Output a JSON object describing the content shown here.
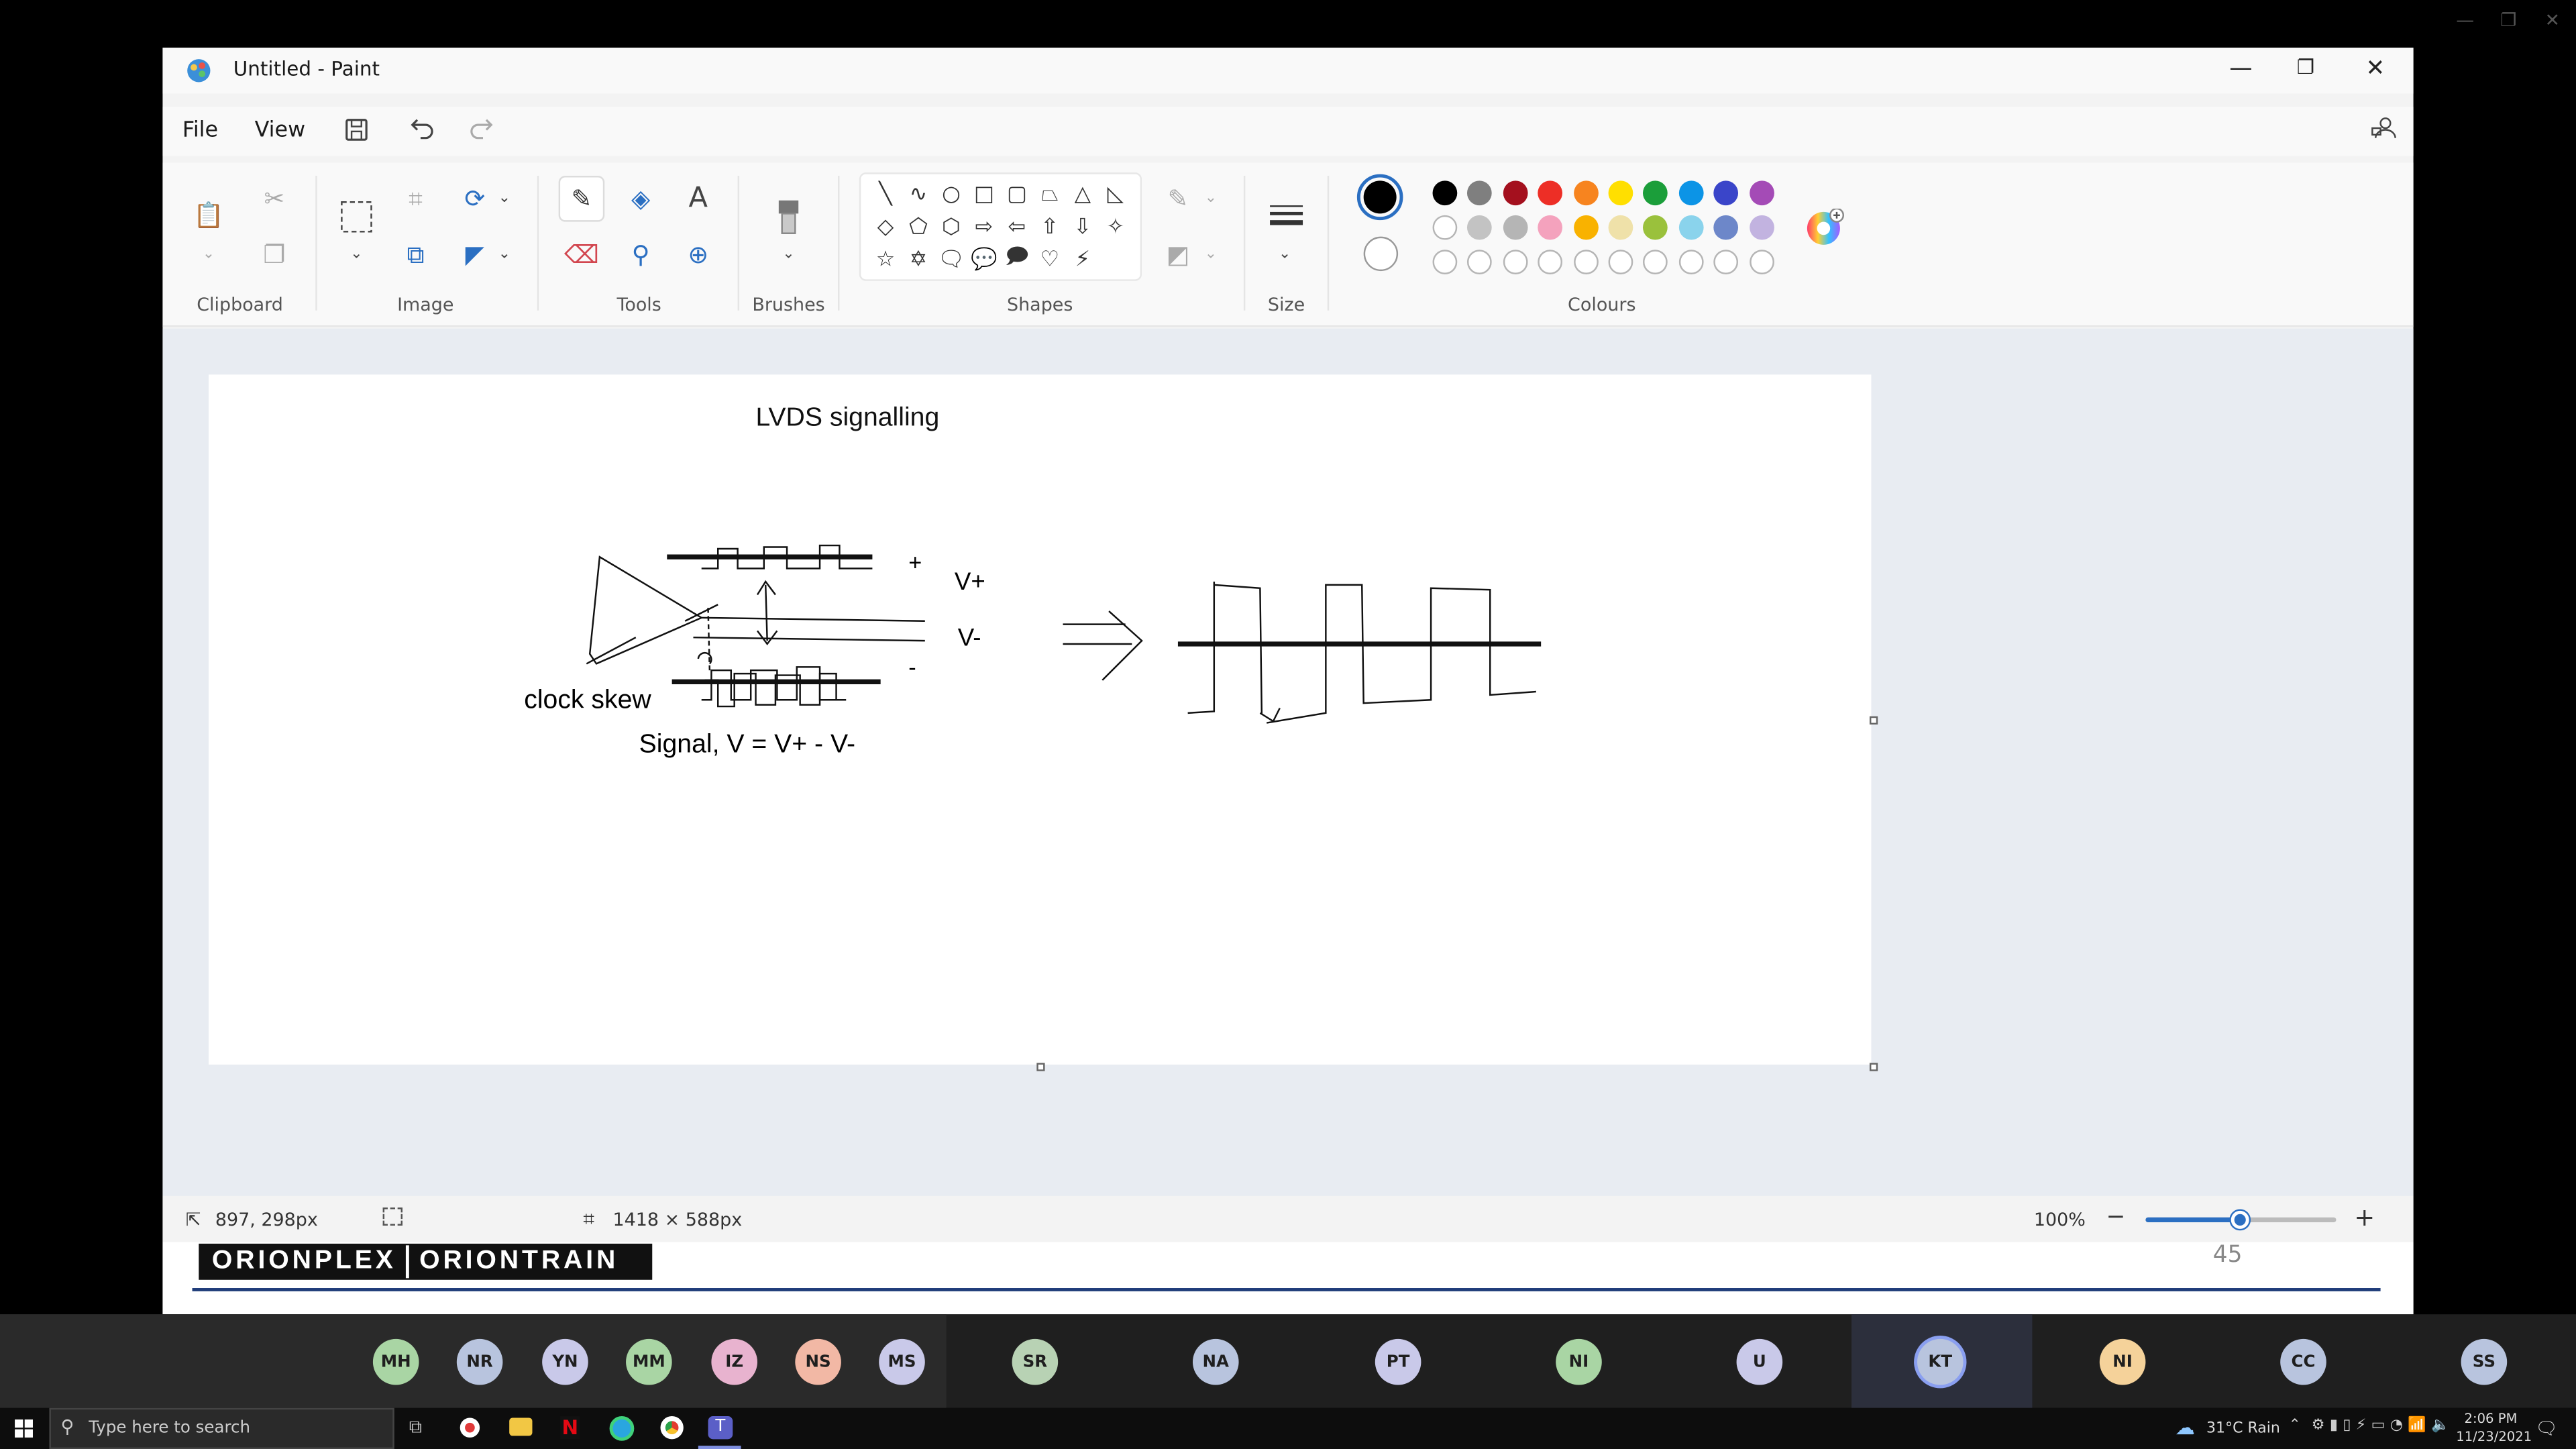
{
  "window": {
    "title": "Untitled - Paint"
  },
  "menu": {
    "file": "File",
    "view": "View"
  },
  "ribbon": {
    "groups": {
      "clipboard": "Clipboard",
      "image": "Image",
      "tools": "Tools",
      "brushes": "Brushes",
      "shapes": "Shapes",
      "size": "Size",
      "colours": "Colours"
    }
  },
  "palette": {
    "primary": "#000000",
    "row1": [
      "#000000",
      "#7f7f7f",
      "#a4101e",
      "#ed2e26",
      "#f7841f",
      "#ffdf00",
      "#1b9e3a",
      "#0c94e6",
      "#3a45c9",
      "#a44bb6"
    ],
    "row2": [
      "#ffffff",
      "#c3c3c3",
      "#b5b5b5",
      "#f4a2bd",
      "#f9b200",
      "#efe1a9",
      "#9ac13c",
      "#8ad3ec",
      "#6d87c9",
      "#c2b3e0"
    ]
  },
  "canvas_text": {
    "title": "LVDS signalling",
    "plus": "+",
    "vplus": "V+",
    "vminus": "V-",
    "minus": "-",
    "clock_skew": "clock skew",
    "signal": "Signal, V = V+ - V-"
  },
  "status": {
    "cursor": "897, 298px",
    "canvas_size": "1418 × 588px",
    "zoom": "100%",
    "zoom_level": 0.5
  },
  "slide": {
    "logo_left": "ORIONPLEX",
    "logo_right": "ORIONTRAIN",
    "page": "45"
  },
  "participants": [
    {
      "initials": "MH",
      "color": "#a9d5a4"
    },
    {
      "initials": "NR",
      "color": "#b8c4de"
    },
    {
      "initials": "YN",
      "color": "#c9c9e9"
    },
    {
      "initials": "MM",
      "color": "#a9d5a4"
    },
    {
      "initials": "IZ",
      "color": "#e8b3cf"
    },
    {
      "initials": "NS",
      "color": "#f2b8a5"
    },
    {
      "initials": "MS",
      "color": "#c9c9e9"
    },
    {
      "initials": "SR",
      "color": "#b8d2b4"
    },
    {
      "initials": "NA",
      "color": "#b8c4de"
    },
    {
      "initials": "PT",
      "color": "#c9c9e9"
    },
    {
      "initials": "NI",
      "color": "#a9d5a4"
    },
    {
      "initials": "U",
      "color": "#c9c9e9"
    },
    {
      "initials": "KT",
      "color": "#b8c4de"
    },
    {
      "initials": "NI",
      "color": "#f5d29a"
    },
    {
      "initials": "CC",
      "color": "#b8c4de"
    },
    {
      "initials": "SS",
      "color": "#b8c4de"
    }
  ],
  "taskbar": {
    "search_placeholder": "Type here to search",
    "weather": "31°C  Rain",
    "time": "2:06 PM",
    "date": "11/23/2021"
  }
}
